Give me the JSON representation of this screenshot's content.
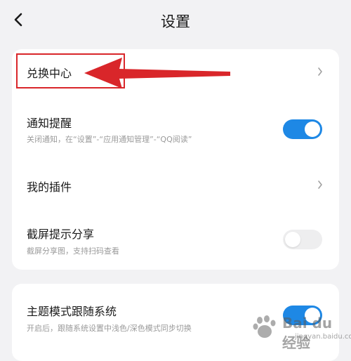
{
  "header": {
    "title": "设置"
  },
  "card1": {
    "exchange": {
      "label": "兑换中心"
    },
    "notify": {
      "label": "通知提醒",
      "sub": "关闭通知，在“设置”-“应用通知管理”-“QQ阅读”",
      "enabled": true
    },
    "plugins": {
      "label": "我的插件"
    },
    "screenshot_share": {
      "label": "截屏提示分享",
      "sub": "截屏分享图，支持扫码查看",
      "enabled": false
    }
  },
  "card2": {
    "theme_follow": {
      "label": "主题模式跟随系统",
      "sub": "开启后，跟随系统设置中浅色/深色模式同步切换",
      "enabled": true
    }
  },
  "watermark": {
    "text": "Bai du 经验",
    "sub": "jingyan.baidu.com"
  },
  "colors": {
    "accent": "#1e88e5",
    "annotation": "#d9262a",
    "background": "#f2f2f4"
  },
  "icons": {
    "back": "chevron-left-icon",
    "row_arrow": "chevron-right-icon"
  }
}
